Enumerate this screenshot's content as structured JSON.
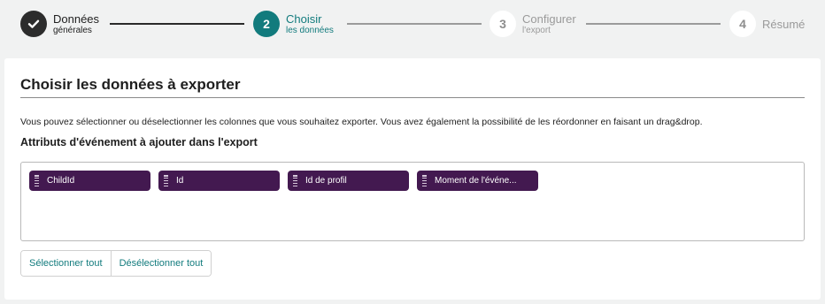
{
  "stepper": {
    "steps": [
      {
        "number": "",
        "title": "Données",
        "subtitle": "générales",
        "state": "done",
        "icon": "check-icon"
      },
      {
        "number": "2",
        "title": "Choisir",
        "subtitle": "les données",
        "state": "active"
      },
      {
        "number": "3",
        "title": "Configurer",
        "subtitle": "l'export",
        "state": "todo"
      },
      {
        "number": "4",
        "title": "Résumé",
        "subtitle": "",
        "state": "todo"
      }
    ]
  },
  "main": {
    "title": "Choisir les données à exporter",
    "description": "Vous pouvez sélectionner ou déselectionner les colonnes que vous souhaitez exporter. Vous avez également la possibilité de les réordonner en faisant un drag&drop.",
    "attributes_heading": "Attributs d'événement à ajouter dans l'export",
    "chips": [
      {
        "label": "ChildId"
      },
      {
        "label": "Id"
      },
      {
        "label": "Id de profil"
      },
      {
        "label": "Moment de l'événe..."
      }
    ],
    "select_all_label": "Sélectionner tout",
    "deselect_all_label": "Désélectionner tout"
  },
  "colors": {
    "accent": "#127b7d",
    "chip": "#431950",
    "done": "#2c2c2c",
    "background": "#f1f2f2"
  }
}
